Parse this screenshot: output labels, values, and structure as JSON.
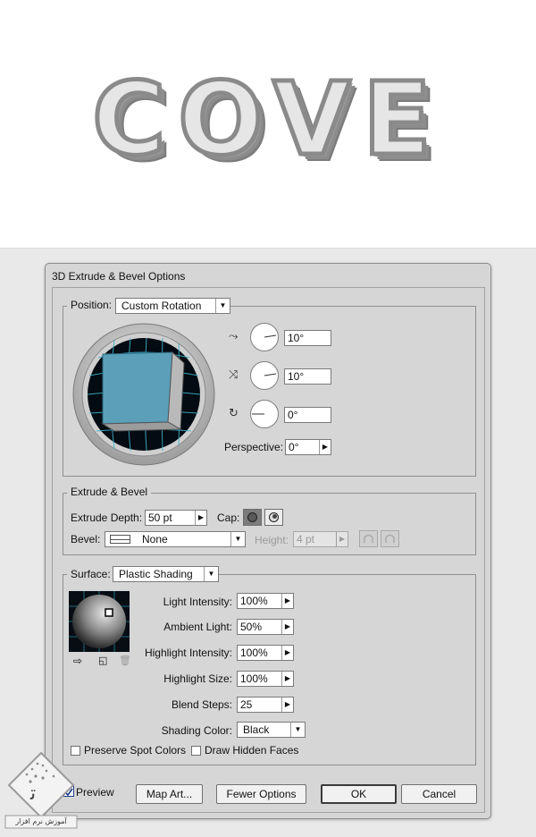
{
  "preview": {
    "text": "COVE"
  },
  "dialog": {
    "title": "3D Extrude & Bevel Options",
    "position": {
      "label": "Position:",
      "preset": "Custom Rotation",
      "x_rotation": "10°",
      "y_rotation": "10°",
      "z_rotation": "0°",
      "perspective_label": "Perspective:",
      "perspective_value": "0°"
    },
    "extrude": {
      "legend": "Extrude & Bevel",
      "depth_label": "Extrude Depth:",
      "depth_value": "50 pt",
      "cap_label": "Cap:",
      "bevel_label": "Bevel:",
      "bevel_value": "None",
      "height_label": "Height:",
      "height_value": "4 pt"
    },
    "surface": {
      "label": "Surface:",
      "preset": "Plastic Shading",
      "light_intensity_label": "Light Intensity:",
      "light_intensity_value": "100%",
      "ambient_light_label": "Ambient Light:",
      "ambient_light_value": "50%",
      "highlight_intensity_label": "Highlight Intensity:",
      "highlight_intensity_value": "100%",
      "highlight_size_label": "Highlight Size:",
      "highlight_size_value": "100%",
      "blend_steps_label": "Blend Steps:",
      "blend_steps_value": "25",
      "shading_color_label": "Shading Color:",
      "shading_color_value": "Black",
      "preserve_spot_label": "Preserve Spot Colors",
      "draw_hidden_label": "Draw Hidden Faces"
    },
    "footer": {
      "preview_label": "Preview",
      "preview_checked": true,
      "map_art_label": "Map Art...",
      "fewer_options_label": "Fewer Options",
      "ok_label": "OK",
      "cancel_label": "Cancel"
    }
  },
  "watermark": {
    "text": "آموزش نرم افزار"
  },
  "colors": {
    "cube_face": "#5b9fb8",
    "grid": "#3ab0c8",
    "dialog_bg": "#d6d6d6"
  }
}
